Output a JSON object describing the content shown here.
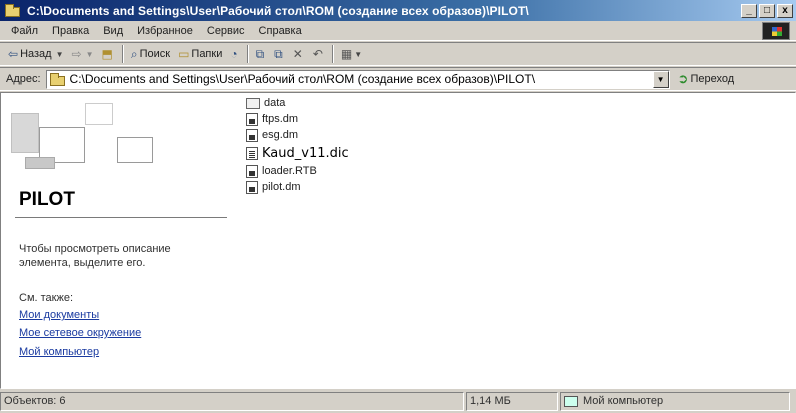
{
  "window": {
    "title": "C:\\Documents and Settings\\User\\Рабочий стол\\ROM (создание всех образов)\\PILOT\\",
    "minimize": "_",
    "maximize": "□",
    "close": "x"
  },
  "menu": [
    "Файл",
    "Правка",
    "Вид",
    "Избранное",
    "Сервис",
    "Справка"
  ],
  "toolbar": {
    "back": "Назад",
    "search": "Поиск",
    "folders": "Папки"
  },
  "address": {
    "label": "Адрес:",
    "value": "C:\\Documents and Settings\\User\\Рабочий стол\\ROM (создание всех образов)\\PILOT\\",
    "go": "Переход"
  },
  "leftpane": {
    "title": "PILOT",
    "description": "Чтобы просмотреть описание элемента, выделите его.",
    "see_also": "См. также:",
    "links": [
      "Мои документы",
      "Мое сетевое окружение",
      "Мой компьютер"
    ]
  },
  "files": [
    {
      "name": "data",
      "icon": "folder-icon"
    },
    {
      "name": "ftps.dm",
      "icon": "dll-file-icon"
    },
    {
      "name": "esg.dm",
      "icon": "dll-file-icon"
    },
    {
      "name": "Kaud_v11.dic",
      "icon": "text-file-icon"
    },
    {
      "name": "loader.RTB",
      "icon": "dll-file-icon"
    },
    {
      "name": "pilot.dm",
      "icon": "dll-file-icon"
    }
  ],
  "status": {
    "objects": "Объектов: 6",
    "size": "1,14 МБ",
    "location": "Мой компьютер"
  }
}
